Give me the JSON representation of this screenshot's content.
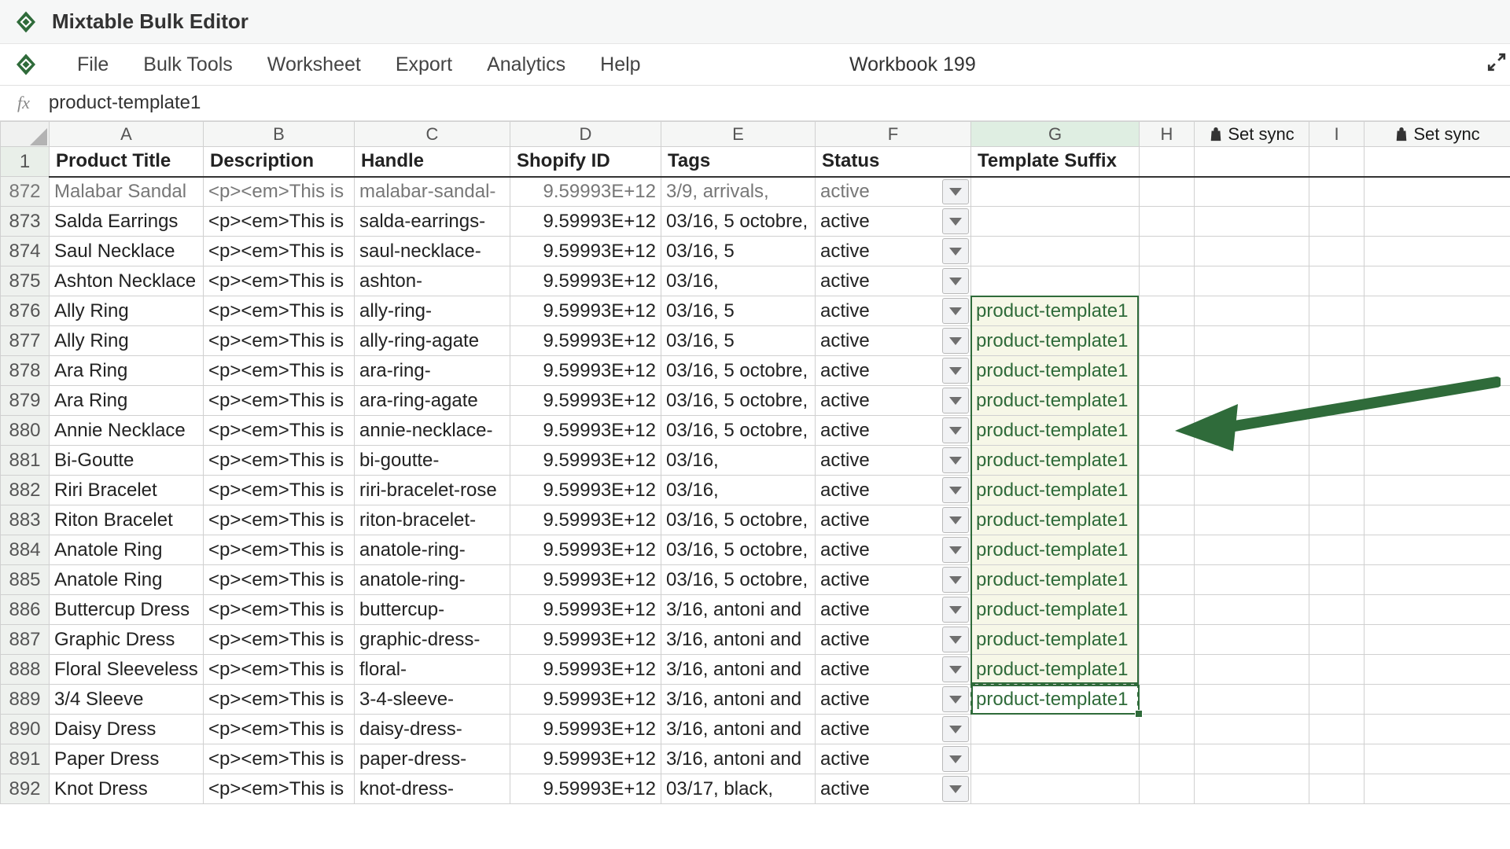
{
  "app": {
    "title": "Mixtable Bulk Editor"
  },
  "menu": {
    "items": [
      "File",
      "Bulk Tools",
      "Worksheet",
      "Export",
      "Analytics",
      "Help"
    ],
    "workbook_title": "Workbook 199"
  },
  "formula_bar": {
    "fx": "fx",
    "value": "product-template1"
  },
  "columns": {
    "letters": [
      "",
      "A",
      "B",
      "C",
      "D",
      "E",
      "F",
      "G",
      "H",
      "",
      "I",
      ""
    ],
    "headers": [
      "1",
      "Product Title",
      "Description",
      "Handle",
      "Shopify ID",
      "Tags",
      "Status",
      "Template Suffix",
      "",
      "Set sync",
      "",
      "Set sync"
    ],
    "selected_letter_index": 7
  },
  "rows": [
    {
      "n": 872,
      "title": "Malabar Sandal",
      "desc": "<p><em>This is",
      "handle": "malabar-sandal-",
      "id": "9.59993E+12",
      "tags": "3/9, arrivals,",
      "status": "active",
      "tmpl": ""
    },
    {
      "n": 873,
      "title": "Salda Earrings",
      "desc": "<p><em>This is",
      "handle": "salda-earrings-",
      "id": "9.59993E+12",
      "tags": "03/16, 5 octobre,",
      "status": "active",
      "tmpl": ""
    },
    {
      "n": 874,
      "title": "Saul Necklace",
      "desc": "<p><em>This is",
      "handle": "saul-necklace-",
      "id": "9.59993E+12",
      "tags": "03/16, 5",
      "status": "active",
      "tmpl": ""
    },
    {
      "n": 875,
      "title": "Ashton Necklace",
      "desc": "<p><em>This is",
      "handle": "ashton-",
      "id": "9.59993E+12",
      "tags": "03/16,",
      "status": "active",
      "tmpl": ""
    },
    {
      "n": 876,
      "title": "Ally Ring",
      "desc": "<p><em>This is",
      "handle": "ally-ring-",
      "id": "9.59993E+12",
      "tags": "03/16, 5",
      "status": "active",
      "tmpl": "product-template1"
    },
    {
      "n": 877,
      "title": "Ally Ring",
      "desc": "<p><em>This is",
      "handle": "ally-ring-agate",
      "id": "9.59993E+12",
      "tags": "03/16, 5",
      "status": "active",
      "tmpl": "product-template1"
    },
    {
      "n": 878,
      "title": "Ara Ring",
      "desc": "<p><em>This is",
      "handle": "ara-ring-",
      "id": "9.59993E+12",
      "tags": "03/16, 5 octobre,",
      "status": "active",
      "tmpl": "product-template1"
    },
    {
      "n": 879,
      "title": "Ara Ring",
      "desc": "<p><em>This is",
      "handle": "ara-ring-agate",
      "id": "9.59993E+12",
      "tags": "03/16, 5 octobre,",
      "status": "active",
      "tmpl": "product-template1"
    },
    {
      "n": 880,
      "title": "Annie Necklace",
      "desc": "<p><em>This is",
      "handle": "annie-necklace-",
      "id": "9.59993E+12",
      "tags": "03/16, 5 octobre,",
      "status": "active",
      "tmpl": "product-template1"
    },
    {
      "n": 881,
      "title": "Bi-Goutte",
      "desc": "<p><em>This is",
      "handle": "bi-goutte-",
      "id": "9.59993E+12",
      "tags": "03/16,",
      "status": "active",
      "tmpl": "product-template1"
    },
    {
      "n": 882,
      "title": "Riri Bracelet",
      "desc": "<p><em>This is",
      "handle": "riri-bracelet-rose",
      "id": "9.59993E+12",
      "tags": "03/16,",
      "status": "active",
      "tmpl": "product-template1"
    },
    {
      "n": 883,
      "title": "Riton Bracelet",
      "desc": "<p><em>This is",
      "handle": "riton-bracelet-",
      "id": "9.59993E+12",
      "tags": "03/16, 5 octobre,",
      "status": "active",
      "tmpl": "product-template1"
    },
    {
      "n": 884,
      "title": "Anatole Ring",
      "desc": "<p><em>This is",
      "handle": "anatole-ring-",
      "id": "9.59993E+12",
      "tags": "03/16, 5 octobre,",
      "status": "active",
      "tmpl": "product-template1"
    },
    {
      "n": 885,
      "title": "Anatole Ring",
      "desc": "<p><em>This is",
      "handle": "anatole-ring-",
      "id": "9.59993E+12",
      "tags": "03/16, 5 octobre,",
      "status": "active",
      "tmpl": "product-template1"
    },
    {
      "n": 886,
      "title": "Buttercup Dress",
      "desc": "<p><em>This is",
      "handle": "buttercup-",
      "id": "9.59993E+12",
      "tags": "3/16, antoni and",
      "status": "active",
      "tmpl": "product-template1"
    },
    {
      "n": 887,
      "title": "Graphic Dress",
      "desc": "<p><em>This is",
      "handle": "graphic-dress-",
      "id": "9.59993E+12",
      "tags": "3/16, antoni and",
      "status": "active",
      "tmpl": "product-template1"
    },
    {
      "n": 888,
      "title": "Floral Sleeveless",
      "desc": "<p><em>This is",
      "handle": "floral-",
      "id": "9.59993E+12",
      "tags": "3/16, antoni and",
      "status": "active",
      "tmpl": "product-template1"
    },
    {
      "n": 889,
      "title": "3/4 Sleeve",
      "desc": "<p><em>This is",
      "handle": "3-4-sleeve-",
      "id": "9.59993E+12",
      "tags": "3/16, antoni and",
      "status": "active",
      "tmpl": "product-template1",
      "active_cell_col": "tmpl"
    },
    {
      "n": 890,
      "title": "Daisy Dress",
      "desc": "<p><em>This is",
      "handle": "daisy-dress-",
      "id": "9.59993E+12",
      "tags": "3/16, antoni and",
      "status": "active",
      "tmpl": ""
    },
    {
      "n": 891,
      "title": "Paper Dress",
      "desc": "<p><em>This is",
      "handle": "paper-dress-",
      "id": "9.59993E+12",
      "tags": "3/16, antoni and",
      "status": "active",
      "tmpl": ""
    },
    {
      "n": 892,
      "title": "Knot Dress",
      "desc": "<p><em>This is",
      "handle": "knot-dress-",
      "id": "9.59993E+12",
      "tags": "03/17, black,",
      "status": "active",
      "tmpl": ""
    }
  ],
  "selection": {
    "solid_range": {
      "col": "G",
      "from_row": 876,
      "to_row": 888
    },
    "dashed_extend": {
      "col": "G",
      "row": 889
    },
    "active_cell": {
      "col": "G",
      "row": 889
    }
  },
  "annotations": {
    "arrow_color": "#2f6b3a"
  },
  "icons": {
    "set_sync_label": "Set sync"
  }
}
